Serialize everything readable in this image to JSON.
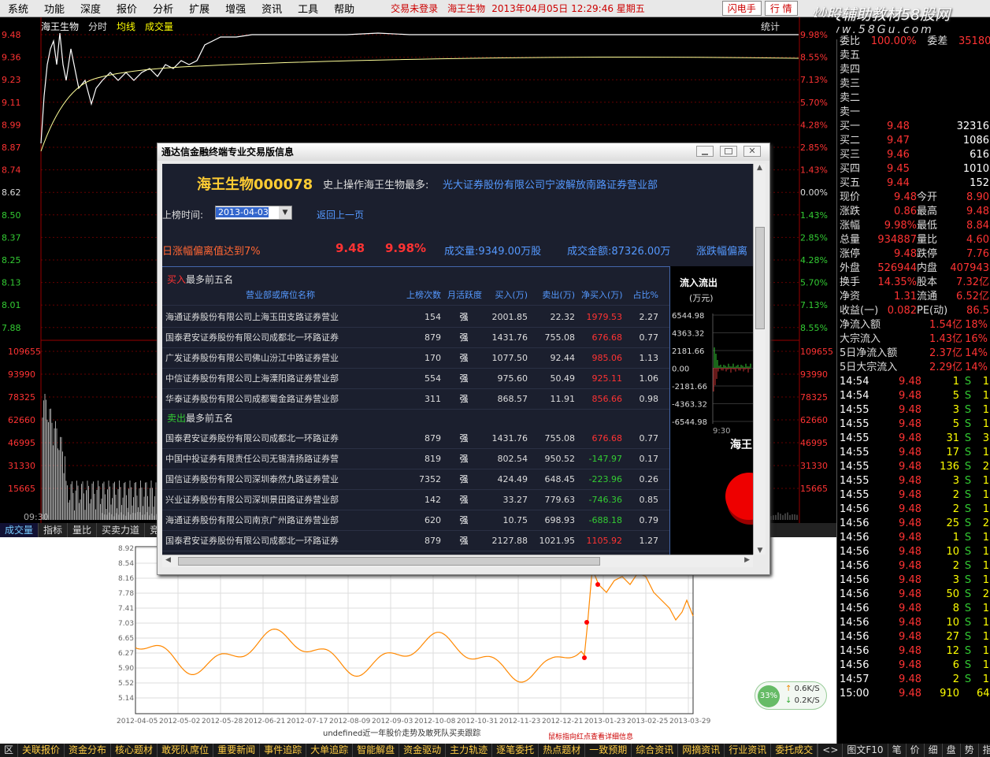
{
  "menu": [
    "系统",
    "功能",
    "深度",
    "报价",
    "分析",
    "扩展",
    "增强",
    "资讯",
    "工具",
    "帮助"
  ],
  "status": {
    "login": "交易未登录",
    "stock": "海王生物",
    "datetime": "2013年04月05日 12:29:46 星期五",
    "btn1": "闪电手",
    "btn2": "行 情"
  },
  "brand": {
    "name": "炒股辅助教材58股网",
    "url": "www.58Gu.com"
  },
  "chart": {
    "stock": "海王生物",
    "mode": "分时",
    "line": "均线",
    "vol": "成交量",
    "stat": "统计",
    "start_time": "09:30",
    "left_prices": [
      "9.48",
      "9.36",
      "9.23",
      "9.11",
      "8.99",
      "8.87",
      "8.74",
      "8.62",
      "8.50",
      "8.37",
      "8.25",
      "8.13",
      "8.01",
      "7.88"
    ],
    "right_pct": [
      "9.98%",
      "8.55%",
      "7.13%",
      "5.70%",
      "4.28%",
      "2.85%",
      "1.43%",
      "0.00%",
      "1.43%",
      "2.85%",
      "4.28%",
      "5.70%",
      "7.13%",
      "8.55%"
    ],
    "vol_ticks": [
      "109655",
      "93990",
      "78325",
      "62660",
      "46995",
      "31330",
      "15665"
    ]
  },
  "tabs": [
    "成交量",
    "指标",
    "量比",
    "买卖力道",
    "竞价图"
  ],
  "lower": {
    "yticks": [
      "8.92",
      "8.54",
      "8.16",
      "7.78",
      "7.41",
      "7.03",
      "6.65",
      "6.27",
      "5.90",
      "5.52",
      "5.14"
    ],
    "xticks": [
      "2012-04-05",
      "2012-05-02",
      "2012-05-28",
      "2012-06-21",
      "2012-07-17",
      "2012-08-09",
      "2012-09-03",
      "2012-10-08",
      "2012-10-31",
      "2012-11-23",
      "2012-12-21",
      "2013-01-23",
      "2013-02-25",
      "2013-03-29"
    ],
    "caption": "undefined近一年股价走势及敢死队买卖跟踪",
    "hint": "鼠标指向红点查看详细信息",
    "speed_pct": "33%",
    "up": "0.6K/S",
    "down": "0.2K/S"
  },
  "dialog": {
    "title": "通达信金融终端专业交易版信息",
    "stock_title": "海王生物000078",
    "most_label": "史上操作海王生物最多:",
    "most_broker": "光大证券股份有限公司宁波解放南路证券营业部",
    "date_label": "上榜时间:",
    "date": "2013-04-03",
    "back": "返回上一页",
    "reason": "日涨幅偏离值达到7%",
    "price": "9.48",
    "pct": "9.98%",
    "vol": "成交量:9349.00万股",
    "amt": "成交金额:87326.00万",
    "dev": "涨跌幅偏离",
    "buy_title_red": "买入",
    "buy_title": "最多前五名",
    "sell_title_green": "卖出",
    "sell_title": "最多前五名",
    "cols": [
      "营业部或席位名称",
      "上榜次数",
      "月活跃度",
      "买入(万)",
      "卖出(万)",
      "净买入(万)",
      "占比%"
    ],
    "buy": [
      [
        "海通证券股份有限公司上海玉田支路证券营业",
        "154",
        "强",
        "2001.85",
        "22.32",
        "1979.53",
        "2.27"
      ],
      [
        "国泰君安证券股份有限公司成都北一环路证券",
        "879",
        "强",
        "1431.76",
        "755.08",
        "676.68",
        "0.77"
      ],
      [
        "广发证券股份有限公司佛山汾江中路证券营业",
        "170",
        "强",
        "1077.50",
        "92.44",
        "985.06",
        "1.13"
      ],
      [
        "中信证券股份有限公司上海溧阳路证券营业部",
        "554",
        "强",
        "975.60",
        "50.49",
        "925.11",
        "1.06"
      ],
      [
        "华泰证券股份有限公司成都蜀金路证券营业部",
        "311",
        "强",
        "868.57",
        "11.91",
        "856.66",
        "0.98"
      ]
    ],
    "sell": [
      [
        "国泰君安证券股份有限公司成都北一环路证券",
        "879",
        "强",
        "1431.76",
        "755.08",
        "676.68",
        "0.77"
      ],
      [
        "中国中投证券有限责任公司无锡清扬路证券营",
        "819",
        "强",
        "802.54",
        "950.52",
        "-147.97",
        "0.17"
      ],
      [
        "国信证券股份有限公司深圳泰然九路证券营业",
        "7352",
        "强",
        "424.49",
        "648.45",
        "-223.96",
        "0.26"
      ],
      [
        "兴业证券股份有限公司深圳景田路证券营业部",
        "142",
        "强",
        "33.27",
        "779.63",
        "-746.36",
        "0.85"
      ],
      [
        "海通证券股份有限公司南京广州路证券营业部",
        "620",
        "强",
        "10.75",
        "698.93",
        "-688.18",
        "0.79"
      ],
      [
        "国泰君安证券股份有限公司成都北一环路证券",
        "879",
        "强",
        "2127.88",
        "1021.95",
        "1105.92",
        "1.27"
      ]
    ],
    "flow_title": "流入流出",
    "flow_unit": "(万元)",
    "flow_ticks": [
      "6544.98",
      "4363.32",
      "2181.66",
      "0.00",
      "-2181.66",
      "-4363.32",
      "-6544.98"
    ],
    "flow_time": "9:30",
    "pie_label": "海王"
  },
  "rp": {
    "top": [
      "委比",
      "100.00%",
      "委差",
      "35180"
    ],
    "sell": [
      "卖五",
      "卖四",
      "卖三",
      "卖二",
      "卖一"
    ],
    "buy": [
      [
        "买一",
        "9.48",
        "32316"
      ],
      [
        "买二",
        "9.47",
        "1086"
      ],
      [
        "买三",
        "9.46",
        "616"
      ],
      [
        "买四",
        "9.45",
        "1010"
      ],
      [
        "买五",
        "9.44",
        "152"
      ]
    ],
    "stats": [
      [
        "现价",
        "9.48",
        "今开",
        "8.90"
      ],
      [
        "涨跌",
        "0.86",
        "最高",
        "9.48"
      ],
      [
        "涨幅",
        "9.98%",
        "最低",
        "8.84"
      ],
      [
        "总量",
        "934887",
        "量比",
        "4.60"
      ],
      [
        "涨停",
        "9.48",
        "跌停",
        "7.76"
      ],
      [
        "外盘",
        "526944",
        "内盘",
        "407943"
      ],
      [
        "换手",
        "14.35%",
        "股本",
        "7.32亿"
      ],
      [
        "净资",
        "1.31",
        "流通",
        "6.52亿"
      ],
      [
        "收益(一)",
        "0.082",
        "PE(动)",
        "86.5"
      ]
    ],
    "flows": [
      [
        "净流入额",
        "1.54亿",
        "18%"
      ],
      [
        "大宗流入",
        "1.43亿",
        "16%"
      ],
      [
        "5日净流入额",
        "2.37亿",
        "14%"
      ],
      [
        "5日大宗流入",
        "2.29亿",
        "14%"
      ]
    ],
    "ticks": [
      [
        "14:54",
        "9.48",
        "1",
        "S",
        "1"
      ],
      [
        "14:54",
        "9.48",
        "5",
        "S",
        "1"
      ],
      [
        "14:55",
        "9.48",
        "3",
        "S",
        "1"
      ],
      [
        "14:55",
        "9.48",
        "5",
        "S",
        "1"
      ],
      [
        "14:55",
        "9.48",
        "31",
        "S",
        "3"
      ],
      [
        "14:55",
        "9.48",
        "17",
        "S",
        "1"
      ],
      [
        "14:55",
        "9.48",
        "136",
        "S",
        "2"
      ],
      [
        "14:55",
        "9.48",
        "3",
        "S",
        "1"
      ],
      [
        "14:55",
        "9.48",
        "2",
        "S",
        "1"
      ],
      [
        "14:56",
        "9.48",
        "2",
        "S",
        "1"
      ],
      [
        "14:56",
        "9.48",
        "25",
        "S",
        "2"
      ],
      [
        "14:56",
        "9.48",
        "1",
        "S",
        "1"
      ],
      [
        "14:56",
        "9.48",
        "10",
        "S",
        "1"
      ],
      [
        "14:56",
        "9.48",
        "2",
        "S",
        "1"
      ],
      [
        "14:56",
        "9.48",
        "3",
        "S",
        "1"
      ],
      [
        "14:56",
        "9.48",
        "50",
        "S",
        "2"
      ],
      [
        "14:56",
        "9.48",
        "8",
        "S",
        "1"
      ],
      [
        "14:56",
        "9.48",
        "10",
        "S",
        "1"
      ],
      [
        "14:56",
        "9.48",
        "27",
        "S",
        "1"
      ],
      [
        "14:56",
        "9.48",
        "12",
        "S",
        "1"
      ],
      [
        "14:56",
        "9.48",
        "6",
        "S",
        "1"
      ],
      [
        "14:57",
        "9.48",
        "2",
        "S",
        "1"
      ],
      [
        "15:00",
        "9.48",
        "910",
        "",
        "64"
      ]
    ]
  },
  "bottom": [
    "区",
    "关联报价",
    "资金分布",
    "核心题材",
    "敢死队席位",
    "重要新闻",
    "事件追踪",
    "大单追踪",
    "智能解盘",
    "资金驱动",
    "主力轨迹",
    "逐笔委托",
    "热点题材",
    "一致预期",
    "综合资讯",
    "网摘资讯",
    "行业资讯",
    "委托成交"
  ],
  "bottom_right": [
    "图文F10",
    "笔",
    "价",
    "细",
    "盘",
    "势",
    "指",
    "值",
    "主"
  ]
}
